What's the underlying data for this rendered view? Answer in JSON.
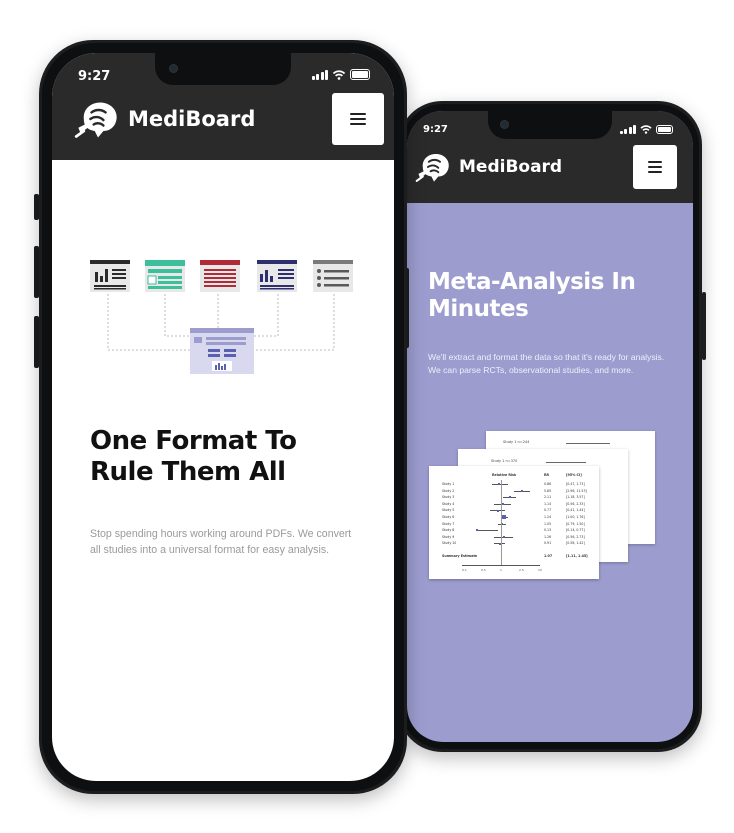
{
  "colors": {
    "header_bg": "#2a2a2a",
    "purple_bg": "#9c9ccf",
    "teal": "#3dbf9c",
    "red": "#b22a35",
    "navy": "#2d2f6e",
    "gray_icon": "#7a7a7a"
  },
  "front_phone": {
    "status": {
      "time": "9:27"
    },
    "header": {
      "brand": "MediBoard",
      "logo_icon": "brain-logo-icon",
      "menu_icon": "hamburger-icon"
    },
    "illustration": {
      "description_icons": [
        "bar-chart-doc-icon",
        "teal-table-doc-icon",
        "red-text-doc-icon",
        "navy-chart-doc-icon",
        "list-doc-icon",
        "combined-format-icon"
      ]
    },
    "hero": {
      "title": "One Format To Rule Them All",
      "text": "Stop spending hours working around PDFs. We convert all studies into a universal format for easy analysis."
    }
  },
  "back_phone": {
    "status": {
      "time": "9:27"
    },
    "header": {
      "brand": "MediBoard",
      "logo_icon": "brain-logo-icon",
      "menu_icon": "hamburger-icon"
    },
    "hero": {
      "title": "Meta-Analysis In Minutes",
      "text": "We'll extract and format the data so that it's ready for analysis. We can parse RCTs, observational studies, and more."
    },
    "forest_plot": {
      "header_studies": [
        "Study 1  n=244",
        "Study 1  n=370"
      ],
      "columns": [
        "Relative Risk",
        "RR",
        "[95% CI]"
      ],
      "rows": [
        [
          "Study 1",
          "0.86",
          "[0.47, 1.73]"
        ],
        [
          "Study 2",
          "5.85",
          "[2.96, 11.53]"
        ],
        [
          "Study 3",
          "2.11",
          "[1.18, 3.57]"
        ],
        [
          "Study 4",
          "1.14",
          "[0.56, 2.33]"
        ],
        [
          "Study 5",
          "0.77",
          "[0.41, 1.44]"
        ],
        [
          "Study 6",
          "1.24",
          "[1.00, 1.76]"
        ],
        [
          "Study 7",
          "1.05",
          "[0.79, 1.50]"
        ],
        [
          "Study 8",
          "0.13",
          "[0.14, 0.77]"
        ],
        [
          "Study 9",
          "1.26",
          "[0.56, 2.73]"
        ],
        [
          "Study 10",
          "0.91",
          "[0.58, 1.42]"
        ]
      ],
      "summary": [
        "Summary Estimate",
        "1.07",
        "[1.11, 1.45]"
      ],
      "axis_ticks": [
        "0.1",
        "0.5",
        "1",
        "2.5",
        "10"
      ]
    }
  }
}
